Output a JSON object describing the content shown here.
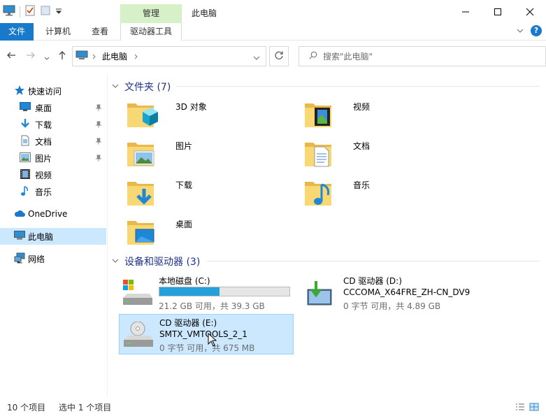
{
  "ribbon": {
    "context_group": "管理",
    "tabs": {
      "file": "文件",
      "computer": "计算机",
      "view": "查看",
      "drive_tools": "驱动器工具"
    }
  },
  "window": {
    "title": "此电脑"
  },
  "address": {
    "path": "此电脑",
    "search_placeholder": "搜索\"此电脑\""
  },
  "sidebar": {
    "quick_access": "快速访问",
    "items": [
      {
        "label": "桌面",
        "icon": "desktop-icon",
        "pinned": true
      },
      {
        "label": "下载",
        "icon": "download-icon",
        "pinned": true
      },
      {
        "label": "文档",
        "icon": "document-icon",
        "pinned": true
      },
      {
        "label": "图片",
        "icon": "picture-icon",
        "pinned": true
      },
      {
        "label": "视频",
        "icon": "video-icon",
        "pinned": false
      },
      {
        "label": "音乐",
        "icon": "music-icon",
        "pinned": false
      }
    ],
    "onedrive": "OneDrive",
    "this_pc": "此电脑",
    "network": "网络"
  },
  "folders": {
    "header": "文件夹 (7)",
    "items": [
      {
        "name": "3D 对象",
        "icon": "3d-objects-folder-icon"
      },
      {
        "name": "视频",
        "icon": "videos-folder-icon"
      },
      {
        "name": "图片",
        "icon": "pictures-folder-icon"
      },
      {
        "name": "文档",
        "icon": "documents-folder-icon"
      },
      {
        "name": "下载",
        "icon": "downloads-folder-icon"
      },
      {
        "name": "音乐",
        "icon": "music-folder-icon"
      },
      {
        "name": "桌面",
        "icon": "desktop-folder-icon"
      }
    ]
  },
  "drives": {
    "header": "设备和驱动器 (3)",
    "items": [
      {
        "name": "本地磁盘 (C:)",
        "info": "21.2 GB 可用，共 39.3 GB",
        "used_fraction": 0.46,
        "icon": "hard-disk-icon"
      },
      {
        "name": "CD 驱动器 (D:)",
        "label": "CCCOMA_X64FRE_ZH-CN_DV9",
        "info": "0 字节 可用，共 4.89 GB",
        "icon": "cd-drive-install-icon"
      },
      {
        "name": "CD 驱动器 (E:)",
        "label": "SMTX_VMTOOLS_2_1",
        "info": "0 字节 可用，共 675 MB",
        "icon": "cd-drive-icon",
        "selected": true
      }
    ]
  },
  "status": {
    "count": "10 个项目",
    "selected": "选中 1 个项目"
  },
  "colors": {
    "accent": "#1979ca",
    "selection": "#cce8ff",
    "context_tab": "#d6f0c8",
    "group_header": "#1e3287",
    "bar_fill": "#26a0da"
  }
}
